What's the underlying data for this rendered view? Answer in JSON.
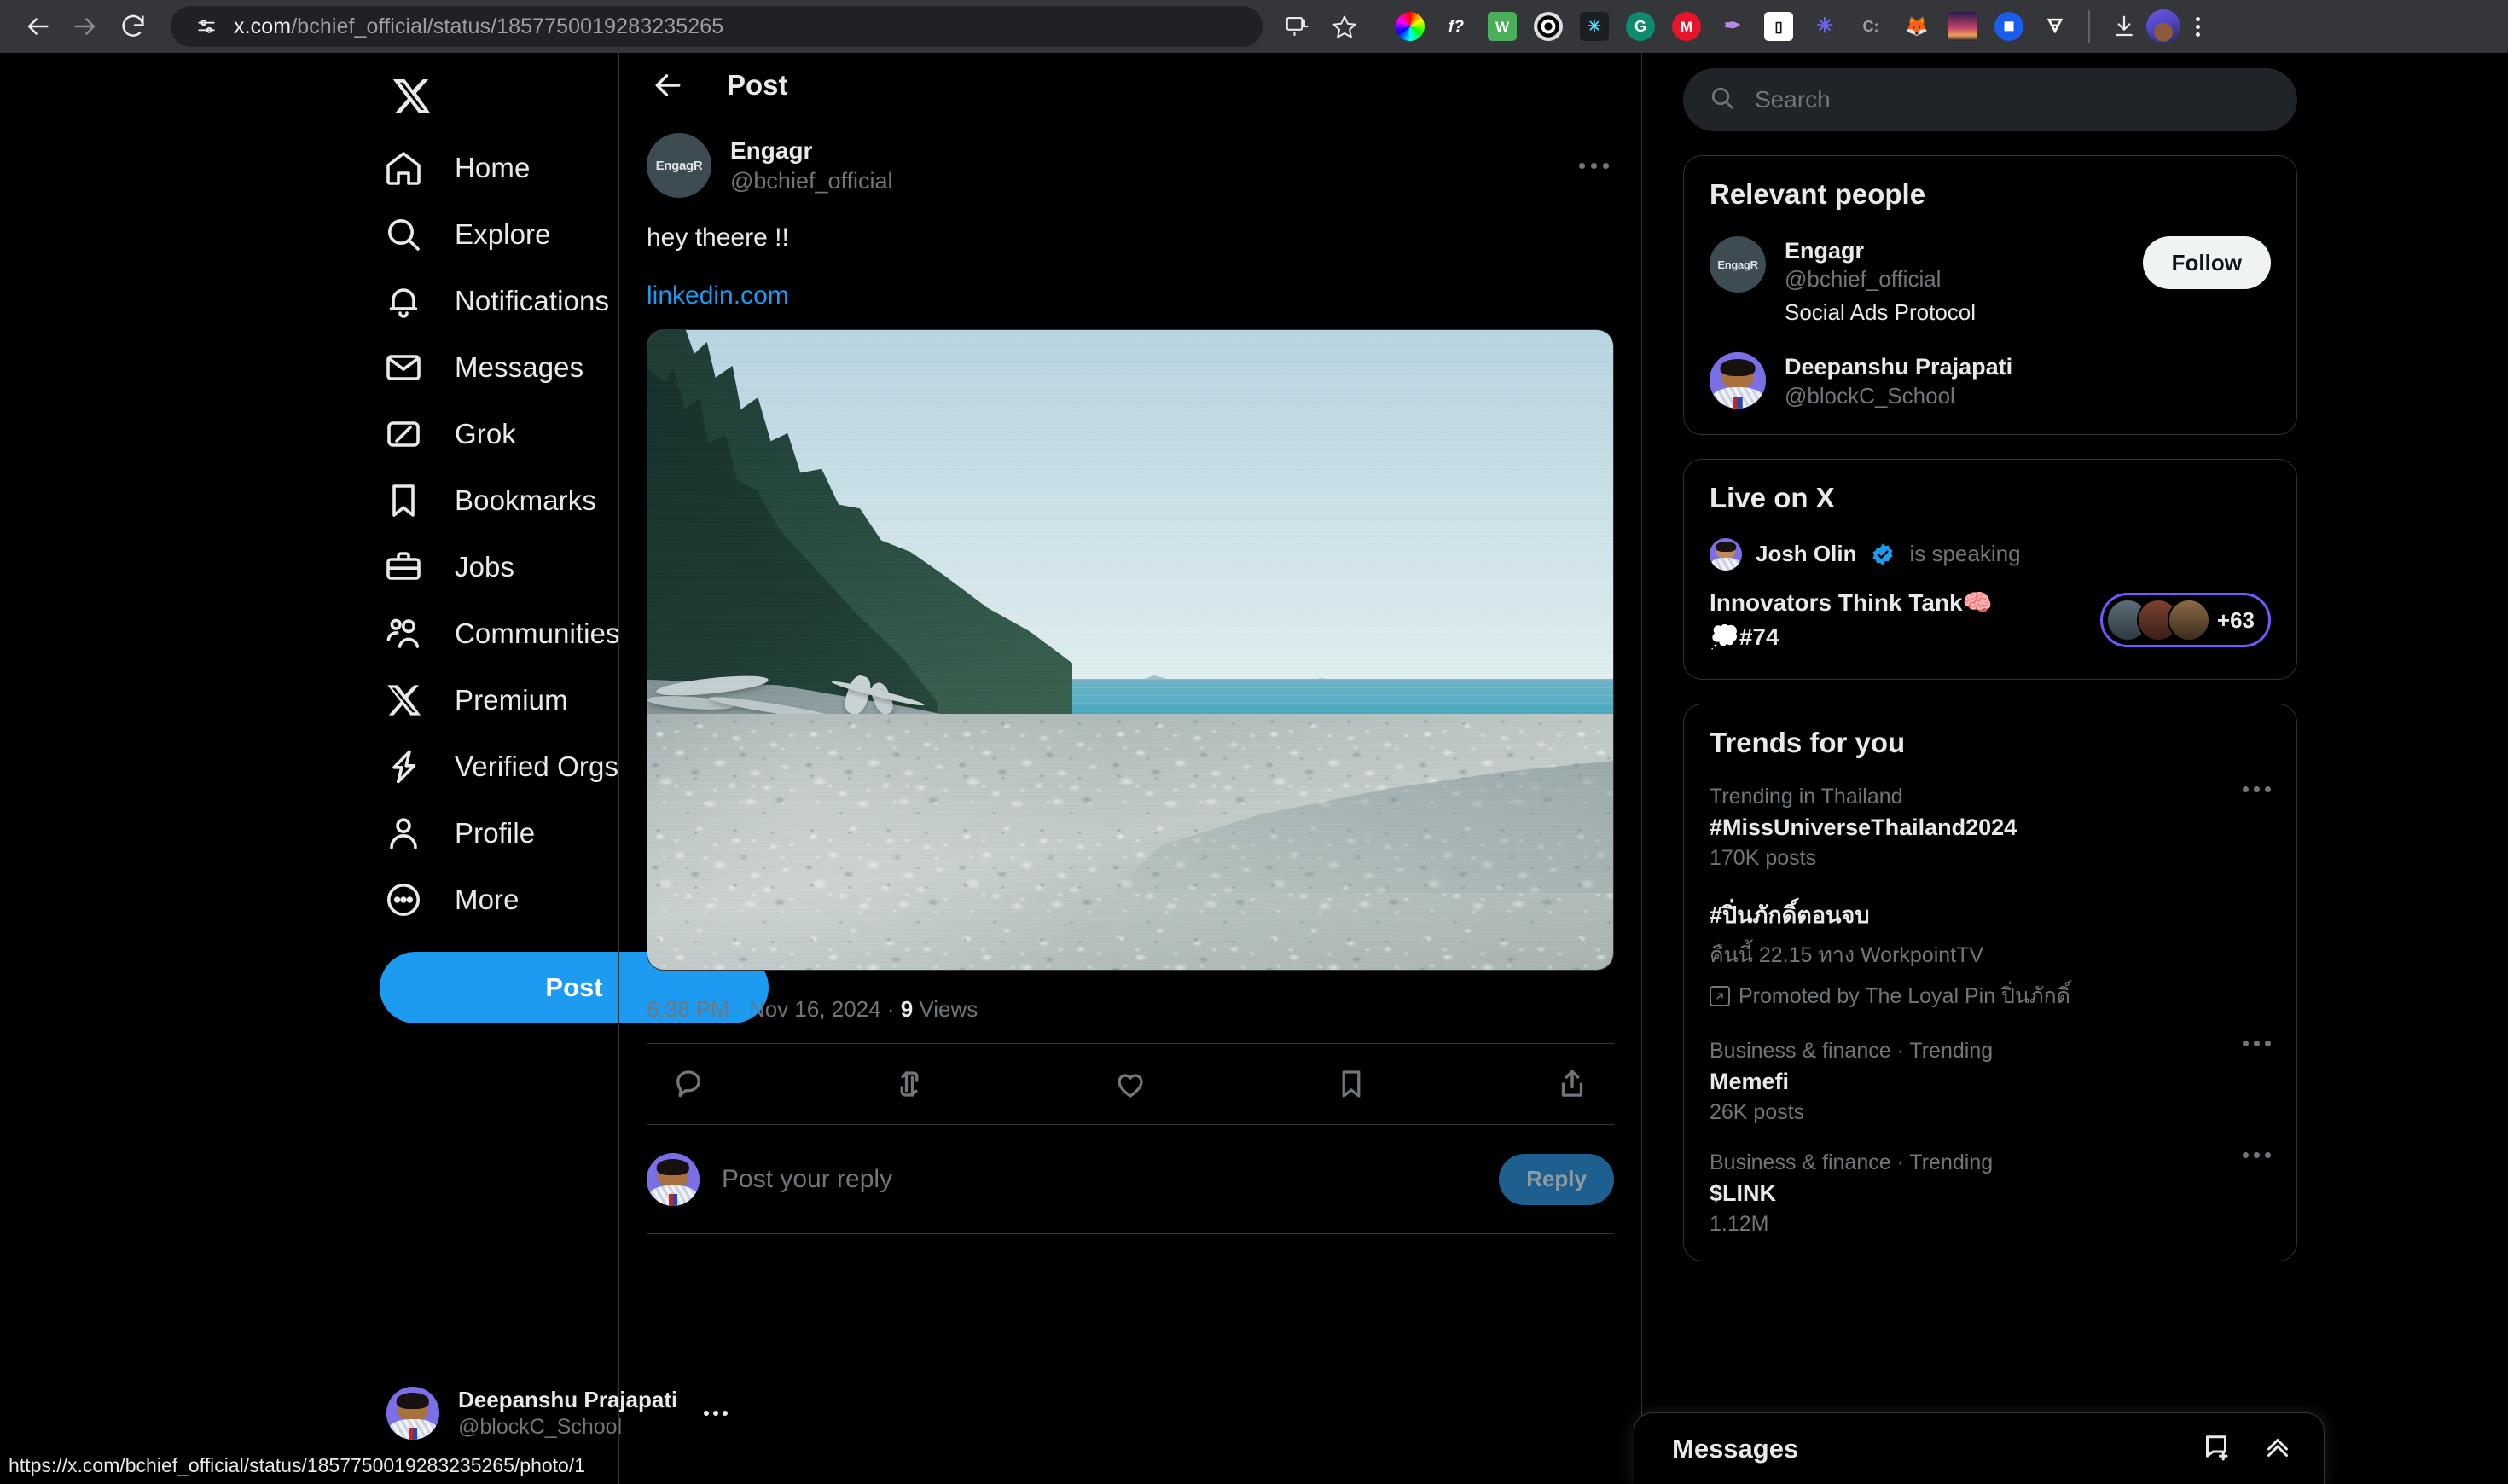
{
  "browser": {
    "url_host": "x.com",
    "url_path": "/bchief_official/status/1857750019283235265",
    "back_icon": "back-arrow-icon",
    "forward_icon": "forward-arrow-icon",
    "reload_icon": "reload-icon",
    "site_info_icon": "tune-settings-icon",
    "cast_icon": "cast-icon",
    "bookmark_icon": "star-icon",
    "downloads_icon": "download-icon",
    "menu_icon": "three-dot-menu-icon",
    "extensions": [
      {
        "name": "color-picker-extension",
        "glyph": "",
        "color": "#ff3b30"
      },
      {
        "name": "font-finder-extension",
        "glyph": "f?",
        "color": "#ffffff"
      },
      {
        "name": "wappalyzer-extension",
        "glyph": "W",
        "color": "#4bae5a"
      },
      {
        "name": "target-rings-extension",
        "glyph": "◎",
        "color": "#d9d9d9"
      },
      {
        "name": "react-devtools-extension",
        "glyph": "⚛",
        "color": "#61dafb"
      },
      {
        "name": "grammarly-extension",
        "glyph": "G",
        "color": "#15c39a"
      },
      {
        "name": "mailtrack-extension",
        "glyph": "M",
        "color": "#e8142c"
      },
      {
        "name": "feather-pen-extension",
        "glyph": "✒",
        "color": "#a06ce0"
      },
      {
        "name": "mobile-view-extension",
        "glyph": "▯",
        "color": "#ffffff"
      },
      {
        "name": "snowflake-extension",
        "glyph": "✳",
        "color": "#6a63f0"
      },
      {
        "name": "clarity-extension",
        "glyph": "C:",
        "color": "#9aa0a6"
      },
      {
        "name": "metamask-extension",
        "glyph": "🦊",
        "color": "#f6851b"
      },
      {
        "name": "sunset-theme-extension",
        "glyph": "▤",
        "color": "#e4572e"
      },
      {
        "name": "blue-circle-extension",
        "glyph": "◉",
        "color": "#1a5ced"
      },
      {
        "name": "bottle-extension",
        "glyph": "🜃",
        "color": "#ffffff"
      }
    ]
  },
  "sidebar": {
    "logo_icon": "x-logo-icon",
    "items": [
      {
        "label": "Home",
        "icon": "home-icon"
      },
      {
        "label": "Explore",
        "icon": "search-icon"
      },
      {
        "label": "Notifications",
        "icon": "bell-icon"
      },
      {
        "label": "Messages",
        "icon": "envelope-icon"
      },
      {
        "label": "Grok",
        "icon": "grok-icon"
      },
      {
        "label": "Bookmarks",
        "icon": "bookmark-icon"
      },
      {
        "label": "Jobs",
        "icon": "briefcase-icon"
      },
      {
        "label": "Communities",
        "icon": "people-icon"
      },
      {
        "label": "Premium",
        "icon": "x-logo-icon"
      },
      {
        "label": "Verified Orgs",
        "icon": "lightning-icon"
      },
      {
        "label": "Profile",
        "icon": "person-icon"
      },
      {
        "label": "More",
        "icon": "more-circle-icon"
      }
    ],
    "post_button": "Post",
    "account": {
      "name": "Deepanshu Prajapati",
      "handle": "@blockC_School",
      "menu_icon": "three-dot-menu-icon"
    }
  },
  "main": {
    "header_title": "Post",
    "back_icon": "back-arrow-icon",
    "post": {
      "author_name": "Engagr",
      "author_handle": "@bchief_official",
      "avatar_label": "EngagR",
      "more_icon": "three-dot-menu-icon",
      "text": "hey theere !!",
      "link": "linkedin.com",
      "image_alt": "pebble beach with evergreen forest, driftwood, and turquoise ocean",
      "timestamp": "6:38 PM · Nov 16, 2024 · ",
      "views_count": "9",
      "views_label": " Views",
      "actions": [
        {
          "name": "reply-icon"
        },
        {
          "name": "repost-icon"
        },
        {
          "name": "like-icon"
        },
        {
          "name": "bookmark-icon"
        },
        {
          "name": "share-icon"
        }
      ]
    },
    "reply_box": {
      "placeholder": "Post your reply",
      "button_label": "Reply"
    }
  },
  "right": {
    "search": {
      "placeholder": "Search",
      "icon": "search-icon"
    },
    "relevant_people": {
      "title": "Relevant people",
      "people": [
        {
          "name": "Engagr",
          "handle": "@bchief_official",
          "bio": "Social Ads Protocol",
          "avatar_label": "EngagR",
          "follow_label": "Follow"
        },
        {
          "name": "Deepanshu Prajapati",
          "handle": "@blockC_School",
          "bio": "",
          "avatar_label": "",
          "follow_label": ""
        }
      ]
    },
    "live_on_x": {
      "title": "Live on X",
      "speaker_name": "Josh Olin",
      "verified_icon": "verified-badge-icon",
      "speaking_text": "is speaking",
      "space_title": "Innovators Think Tank🧠",
      "space_subtitle": "💭#74",
      "listeners_extra": "+63"
    },
    "trends": {
      "title": "Trends for you",
      "items": [
        {
          "category": "Trending in Thailand",
          "name": "#MissUniverseThailand2024",
          "sub": "170K posts",
          "promoted": ""
        },
        {
          "category": "",
          "name": "#ปิ่นภักดิ์ตอนจบ",
          "sub": "คืนนี้ 22.15 ทาง WorkpointTV",
          "promoted": "Promoted by The Loyal Pin ปิ่นภักดิ์"
        },
        {
          "category": "Business & finance · Trending",
          "name": "Memefi",
          "sub": "26K posts",
          "promoted": ""
        },
        {
          "category": "Business & finance · Trending",
          "name": "$LINK",
          "sub": "1.12M",
          "promoted": ""
        }
      ]
    },
    "messages_dock": {
      "title": "Messages",
      "new_message_icon": "new-message-icon",
      "expand_icon": "chevron-up-icon"
    }
  },
  "status_bar": {
    "url": "https://x.com/bchief_official/status/1857750019283235265/photo/1"
  },
  "colors": {
    "accent": "#1d9bf0",
    "background": "#000000",
    "border": "#2f3336",
    "muted_text": "#71767b",
    "text": "#e7e9ea",
    "live_purple": "#7856ff",
    "follow_bg": "#eff3f4"
  }
}
